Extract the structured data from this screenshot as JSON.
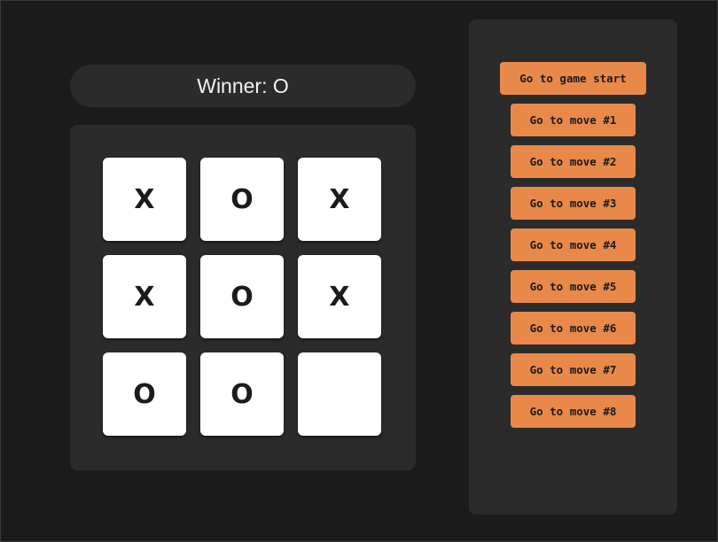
{
  "status": "Winner: O",
  "board": {
    "squares": [
      "X",
      "O",
      "X",
      "X",
      "O",
      "X",
      "O",
      "O",
      ""
    ]
  },
  "history": {
    "moves": [
      "Go to game start",
      "Go to move #1",
      "Go to move #2",
      "Go to move #3",
      "Go to move #4",
      "Go to move #5",
      "Go to move #6",
      "Go to move #7",
      "Go to move #8"
    ]
  },
  "colors": {
    "background": "#1b1b1b",
    "panel": "#2b2b2b",
    "square": "#ffffff",
    "accent": "#e8894a",
    "text_light": "#f2f2f2",
    "text_dark": "#1b1b1b"
  }
}
